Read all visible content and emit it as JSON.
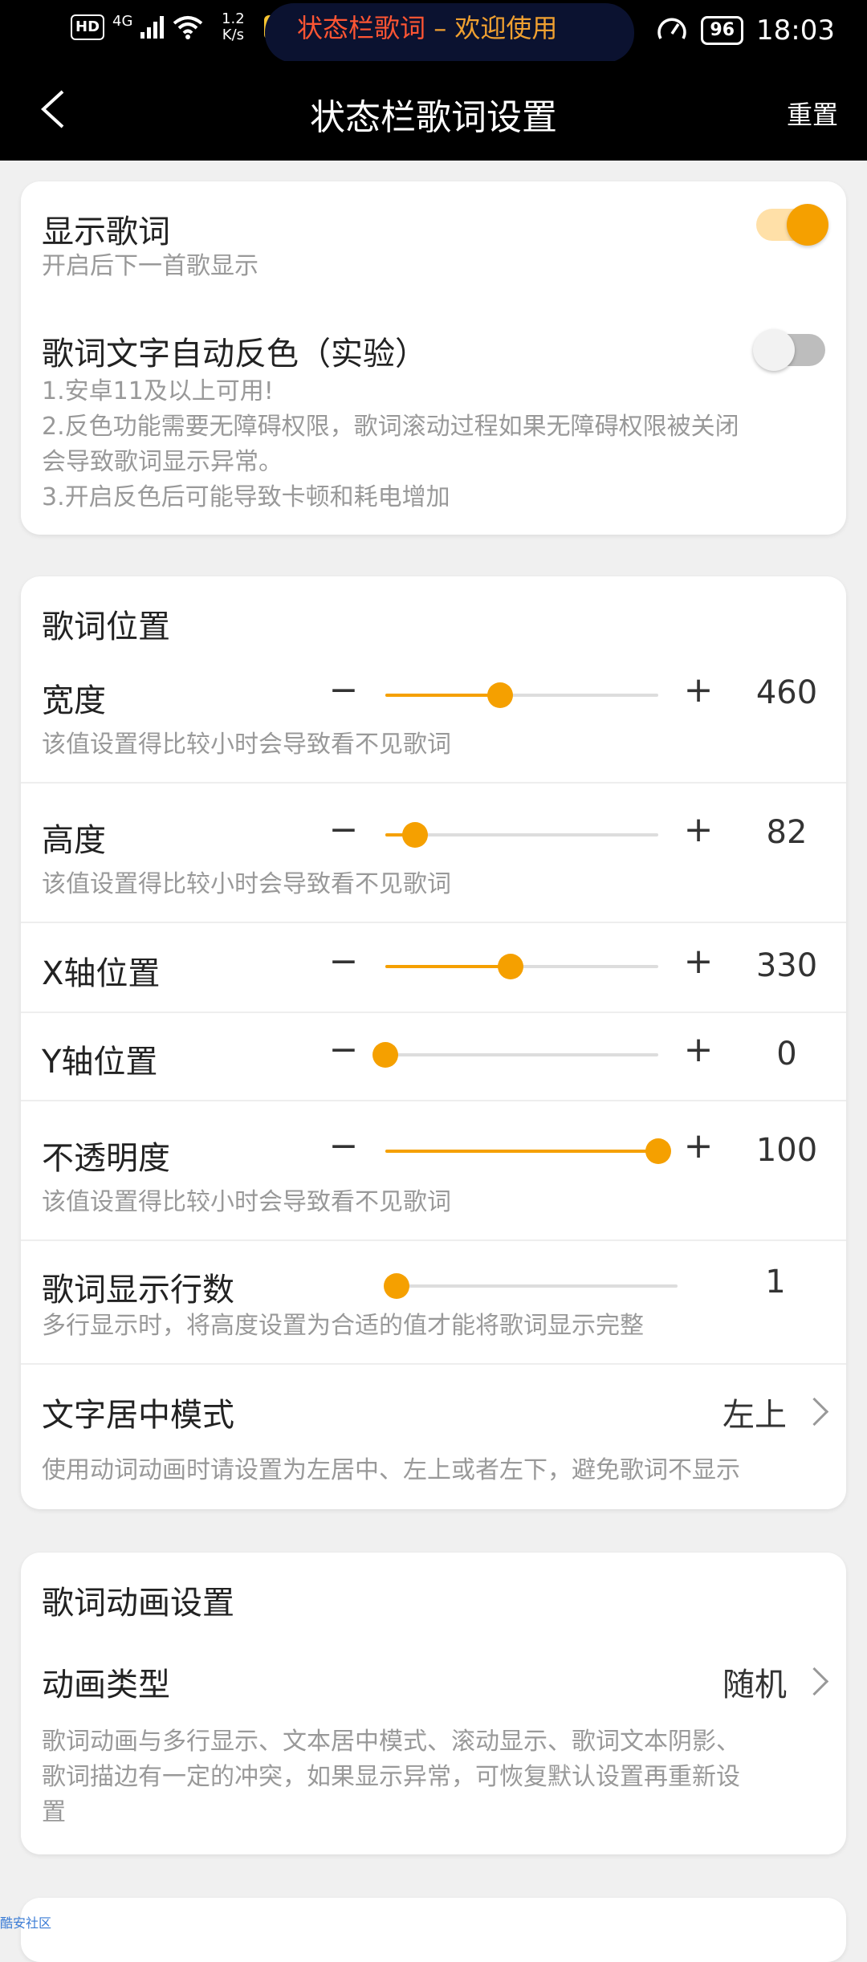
{
  "status_bar": {
    "hd": "HD",
    "signal": "4G",
    "net_speed": "1.2",
    "net_unit": "K/s",
    "lyric_part1": "状态栏歌词",
    "lyric_part2": " – 欢迎使用",
    "battery": "96",
    "time": "18:03"
  },
  "header": {
    "title": "状态栏歌词设置",
    "reset": "重置"
  },
  "card1": {
    "show_lyrics": {
      "label": "显示歌词",
      "desc": "开启后下一首歌显示",
      "on": true
    },
    "auto_invert": {
      "label": "歌词文字自动反色（实验）",
      "desc1": "1.安卓11及以上可用!",
      "desc2": "2.反色功能需要无障碍权限，歌词滚动过程如果无障碍权限被关闭",
      "desc3": "会导致歌词显示异常。",
      "desc4": "3.开启反色后可能导致卡顿和耗电增加",
      "on": false
    }
  },
  "position": {
    "title": "歌词位置",
    "minus": "−",
    "plus": "+",
    "width": {
      "label": "宽度",
      "value": "460",
      "fraction": 0.42,
      "desc": "该值设置得比较小时会导致看不见歌词"
    },
    "height": {
      "label": "高度",
      "value": "82",
      "fraction": 0.11,
      "desc": "该值设置得比较小时会导致看不见歌词"
    },
    "x": {
      "label": "X轴位置",
      "value": "330",
      "fraction": 0.46
    },
    "y": {
      "label": "Y轴位置",
      "value": "0",
      "fraction": 0.0
    },
    "opacity": {
      "label": "不透明度",
      "value": "100",
      "fraction": 1.0,
      "desc": "该值设置得比较小时会导致看不见歌词"
    },
    "lines": {
      "label": "歌词显示行数",
      "value": "1",
      "fraction": 0.0,
      "desc": "多行显示时，将高度设置为合适的值才能将歌词显示完整"
    },
    "align": {
      "label": "文字居中模式",
      "value": "左上",
      "desc": "使用动词动画时请设置为左居中、左上或者左下，避免歌词不显示"
    }
  },
  "animation": {
    "title": "歌词动画设置",
    "type_label": "动画类型",
    "type_value": "随机",
    "desc1": "歌词动画与多行显示、文本居中模式、滚动显示、歌词文本阴影、",
    "desc2": "歌词描边有一定的冲突，如果显示异常，可恢复默认设置再重新设",
    "desc3": "置"
  },
  "watermark": "酷安社区",
  "colors": {
    "accent": "#f5a000",
    "header_bg": "#000000"
  }
}
